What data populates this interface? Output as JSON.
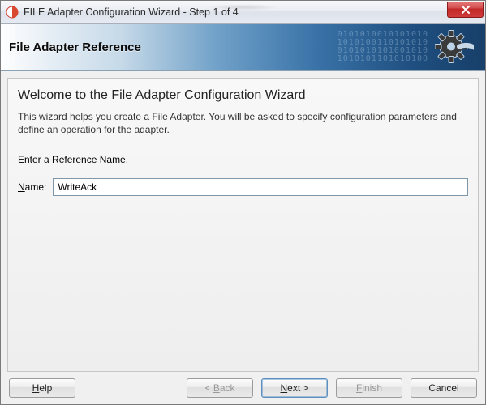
{
  "window": {
    "title": "FILE Adapter Configuration Wizard - Step 1 of 4"
  },
  "banner": {
    "title": "File Adapter Reference"
  },
  "content": {
    "heading": "Welcome to the File Adapter Configuration Wizard",
    "description": "This wizard helps you create a File Adapter. You will be asked to specify configuration parameters and define an operation for the adapter.",
    "prompt": "Enter a Reference Name.",
    "name_label_prefix": "N",
    "name_label_rest": "ame:",
    "name_value": "WriteAck"
  },
  "buttons": {
    "help": "Help",
    "back": "< Back",
    "next": "Next >",
    "finish": "Finish",
    "cancel": "Cancel",
    "help_mn": "H",
    "help_rest": "elp",
    "back_mn": "B",
    "back_pre": "< ",
    "back_rest": "ack",
    "next_mn": "N",
    "next_rest": "ext >",
    "finish_mn": "F",
    "finish_rest": "inish"
  }
}
